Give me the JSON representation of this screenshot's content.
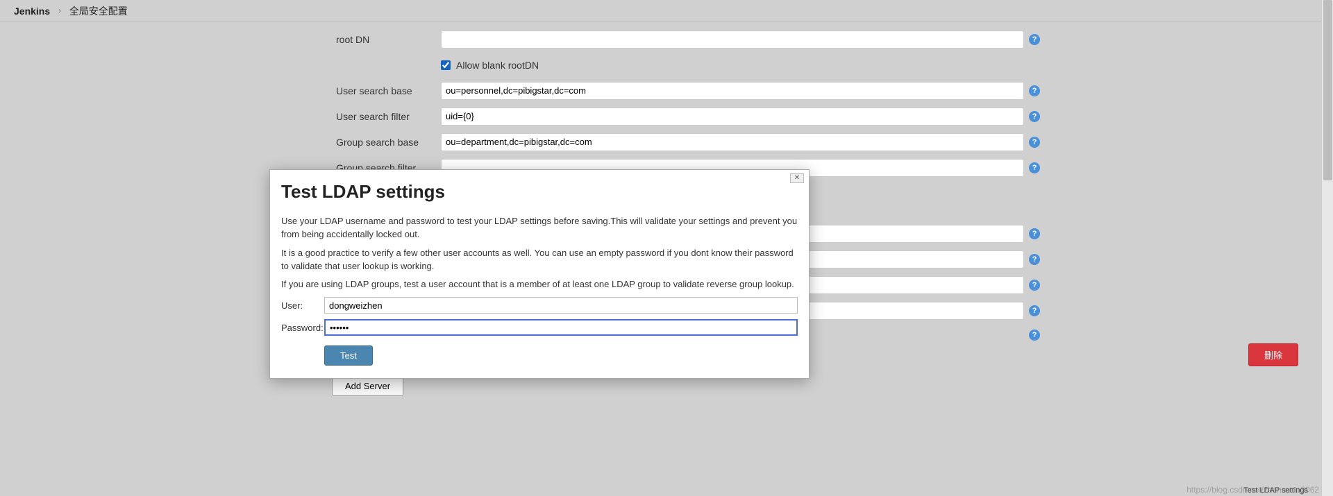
{
  "breadcrumb": {
    "root": "Jenkins",
    "current": "全局安全配置"
  },
  "fields": {
    "rootDN": {
      "label": "root DN",
      "value": ""
    },
    "allowBlankRootDN": {
      "label": "Allow blank rootDN",
      "checked": true
    },
    "userSearchBase": {
      "label": "User search base",
      "value": "ou=personnel,dc=pibigstar,dc=com"
    },
    "userSearchFilter": {
      "label": "User search filter",
      "value": "uid={0}"
    },
    "groupSearchBase": {
      "label": "Group search base",
      "value": "ou=department,dc=pibigstar,dc=com"
    },
    "groupSearchFilter": {
      "label": "Group search filter",
      "value": ""
    },
    "hidden1": {
      "value": ""
    },
    "hidden2": {
      "value": ""
    },
    "hidden3": {
      "value": ""
    },
    "hidden4": {
      "value": ""
    }
  },
  "buttons": {
    "addServer": "Add Server",
    "delete": "删除",
    "testLdap": "Test LDAP settings"
  },
  "modal": {
    "title": "Test LDAP settings",
    "p1": "Use your LDAP username and password to test your LDAP settings before saving.This will validate your settings and prevent you from being accidentally locked out.",
    "p2": "It is a good practice to verify a few other user accounts as well. You can use an empty password if you dont know their password to validate that user lookup is working.",
    "p3": "If you are using LDAP groups, test a user account that is a member of at least one LDAP group to validate reverse group lookup.",
    "userLabel": "User:",
    "userValue": "dongweizhen",
    "passwordLabel": "Password:",
    "passwordValue": "••••••",
    "testButton": "Test",
    "closeGlyph": "✕"
  },
  "watermark": "https://blog.csdn.net/zhanremo3062"
}
